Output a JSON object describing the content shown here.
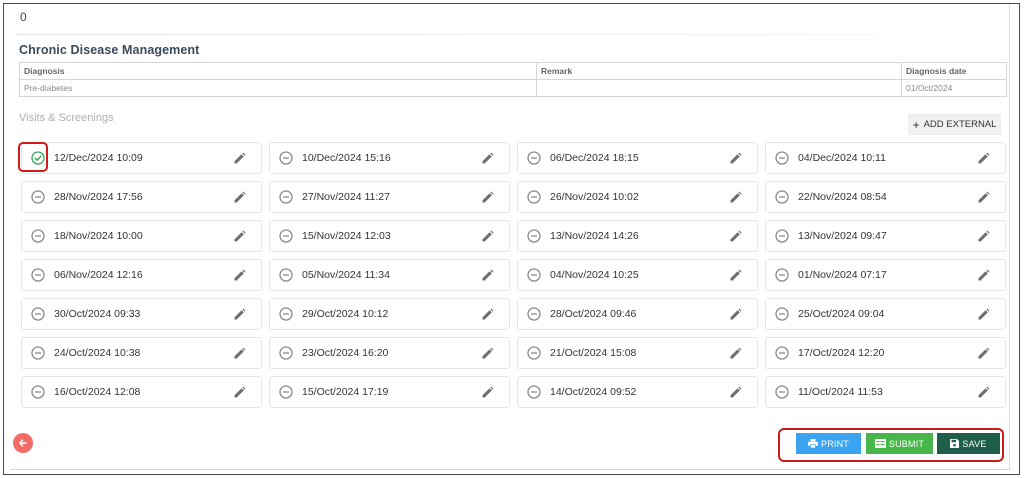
{
  "header": {
    "counter": "0"
  },
  "section": {
    "title": "Chronic Disease Management"
  },
  "diagnosis_table": {
    "headers": {
      "diagnosis": "Diagnosis",
      "remark": "Remark",
      "date": "Diagnosis date"
    },
    "row": {
      "diagnosis": "Pre-diabetes",
      "remark": "",
      "date": "01/Oct/2024"
    }
  },
  "visits": {
    "title": "Visits & Screenings",
    "add_external_label": "ADD EXTERNAL",
    "items": [
      {
        "date": "12/Dec/2024 10:09",
        "status": "completed"
      },
      {
        "date": "10/Dec/2024 15:16",
        "status": "pending"
      },
      {
        "date": "06/Dec/2024 18:15",
        "status": "pending"
      },
      {
        "date": "04/Dec/2024 10:11",
        "status": "pending"
      },
      {
        "date": "28/Nov/2024 17:56",
        "status": "pending"
      },
      {
        "date": "27/Nov/2024 11:27",
        "status": "pending"
      },
      {
        "date": "26/Nov/2024 10:02",
        "status": "pending"
      },
      {
        "date": "22/Nov/2024 08:54",
        "status": "pending"
      },
      {
        "date": "18/Nov/2024 10:00",
        "status": "pending"
      },
      {
        "date": "15/Nov/2024 12:03",
        "status": "pending"
      },
      {
        "date": "13/Nov/2024 14:26",
        "status": "pending"
      },
      {
        "date": "13/Nov/2024 09:47",
        "status": "pending"
      },
      {
        "date": "06/Nov/2024 12:16",
        "status": "pending"
      },
      {
        "date": "05/Nov/2024 11:34",
        "status": "pending"
      },
      {
        "date": "04/Nov/2024 10:25",
        "status": "pending"
      },
      {
        "date": "01/Nov/2024 07:17",
        "status": "pending"
      },
      {
        "date": "30/Oct/2024 09:33",
        "status": "pending"
      },
      {
        "date": "29/Oct/2024 10:12",
        "status": "pending"
      },
      {
        "date": "28/Oct/2024 09:46",
        "status": "pending"
      },
      {
        "date": "25/Oct/2024 09:04",
        "status": "pending"
      },
      {
        "date": "24/Oct/2024 10:38",
        "status": "pending"
      },
      {
        "date": "23/Oct/2024 16:20",
        "status": "pending"
      },
      {
        "date": "21/Oct/2024 15:08",
        "status": "pending"
      },
      {
        "date": "17/Oct/2024 12:20",
        "status": "pending"
      },
      {
        "date": "16/Oct/2024 12:08",
        "status": "pending"
      },
      {
        "date": "15/Oct/2024 17:19",
        "status": "pending"
      },
      {
        "date": "14/Oct/2024 09:52",
        "status": "pending"
      },
      {
        "date": "11/Oct/2024 11:53",
        "status": "pending"
      }
    ]
  },
  "actions": {
    "print_label": "PRINT",
    "submit_label": "SUBMIT",
    "save_label": "SAVE"
  },
  "colors": {
    "print": "#3aa3f2",
    "submit": "#48b64a",
    "save": "#1e5e4b",
    "completed": "#3aa55a",
    "pending": "#8a8a8a",
    "highlight": "#c81b1b",
    "back": "#f26b66"
  }
}
